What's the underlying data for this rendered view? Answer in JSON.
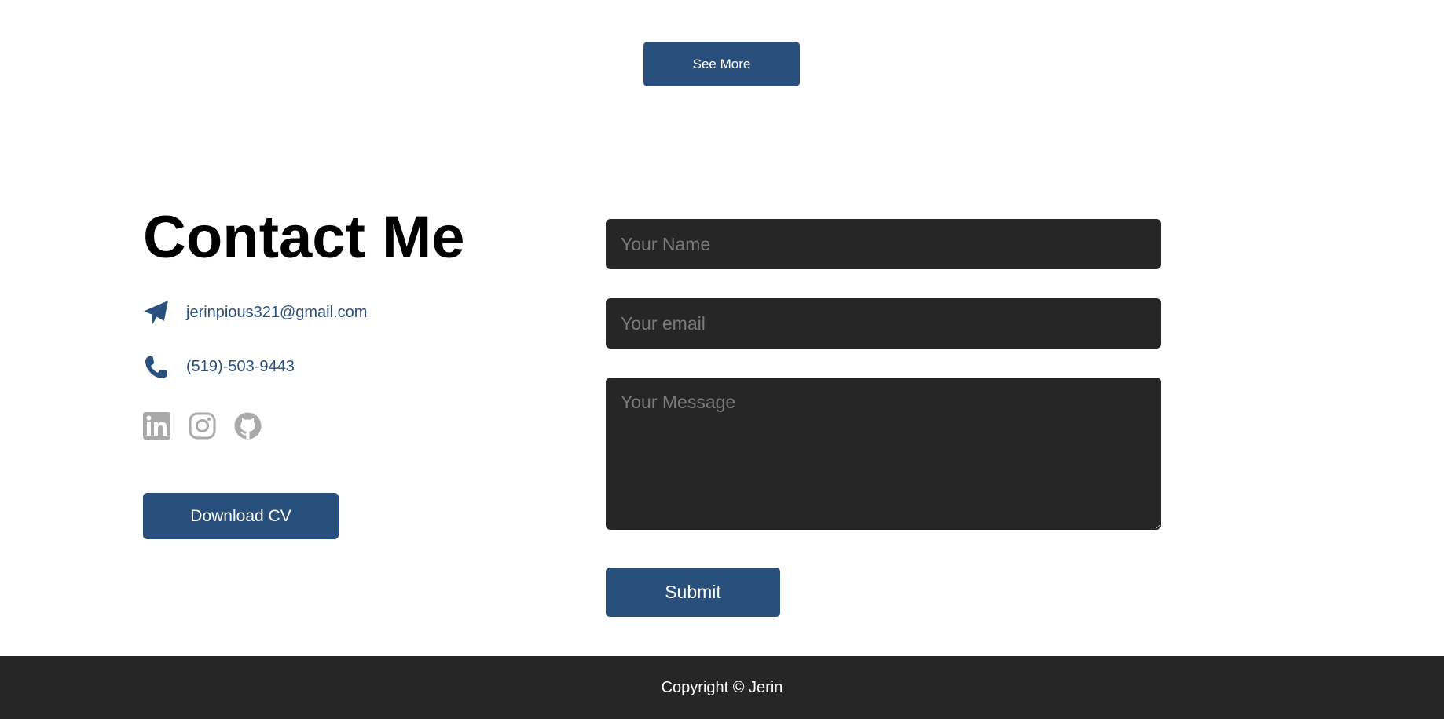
{
  "projects": {
    "see_more_label": "See More"
  },
  "contact": {
    "title": "Contact Me",
    "email": "jerinpious321@gmail.com",
    "phone": "(519)-503-9443",
    "icons": {
      "email": "paper-plane-icon",
      "phone": "phone-icon"
    },
    "socials": [
      {
        "name": "linkedin-icon"
      },
      {
        "name": "instagram-icon"
      },
      {
        "name": "github-icon"
      }
    ],
    "download_cv_label": "Download CV"
  },
  "form": {
    "name_placeholder": "Your Name",
    "email_placeholder": "Your email",
    "message_placeholder": "Your Message",
    "submit_label": "Submit"
  },
  "footer": {
    "copyright": "Copyright © Jerin"
  },
  "colors": {
    "accent": "#29507d",
    "field_bg": "#262626",
    "footer_bg": "#262626",
    "social_icon": "#a9a9a9"
  }
}
